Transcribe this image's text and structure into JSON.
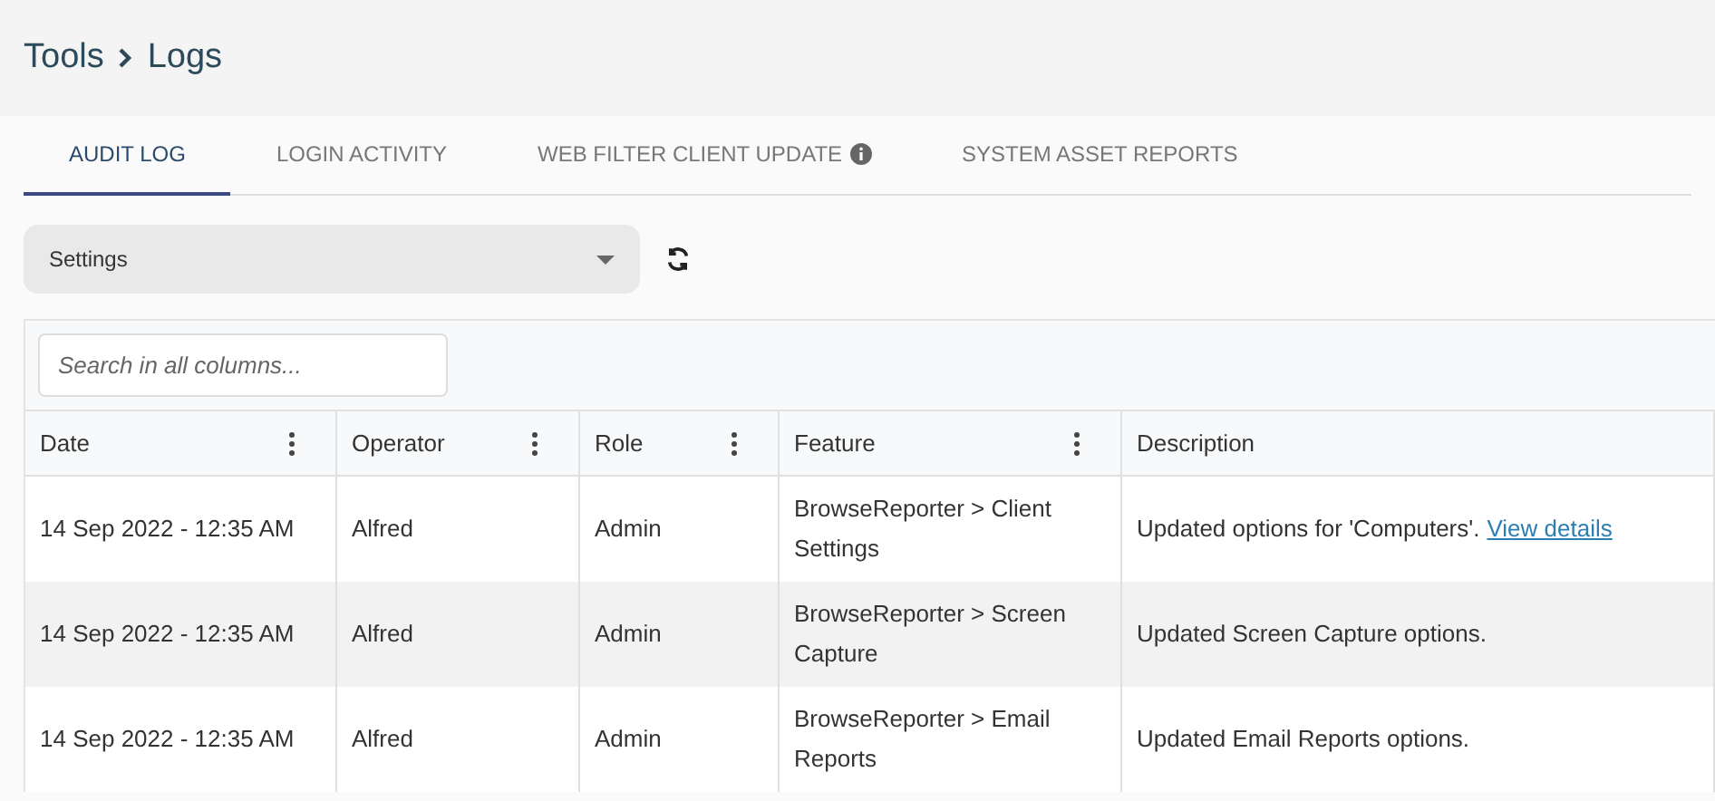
{
  "breadcrumb": [
    "Tools",
    "Logs"
  ],
  "tabs": [
    {
      "label": "AUDIT LOG",
      "selected": true,
      "info": false
    },
    {
      "label": "LOGIN ACTIVITY",
      "selected": false,
      "info": false
    },
    {
      "label": "WEB FILTER CLIENT UPDATE",
      "selected": false,
      "info": true
    },
    {
      "label": "SYSTEM ASSET REPORTS",
      "selected": false,
      "info": false
    }
  ],
  "filter": {
    "value": "Settings"
  },
  "search": {
    "placeholder": "Search in all columns..."
  },
  "table": {
    "columns": [
      {
        "label": "Date",
        "menu": true
      },
      {
        "label": "Operator",
        "menu": true
      },
      {
        "label": "Role",
        "menu": true
      },
      {
        "label": "Feature",
        "menu": true
      },
      {
        "label": "Description",
        "menu": false
      }
    ],
    "rows": [
      {
        "date": "14 Sep 2022 - 12:35 AM",
        "operator": "Alfred",
        "role": "Admin",
        "feature": "BrowseReporter > Client Settings",
        "description": "Updated options for 'Computers'.",
        "link": "View details"
      },
      {
        "date": "14 Sep 2022 - 12:35 AM",
        "operator": "Alfred",
        "role": "Admin",
        "feature": "BrowseReporter > Screen Capture",
        "description": "Updated Screen Capture options."
      },
      {
        "date": "14 Sep 2022 - 12:35 AM",
        "operator": "Alfred",
        "role": "Admin",
        "feature": "BrowseReporter > Email Reports",
        "description": "Updated Email Reports options."
      }
    ]
  }
}
